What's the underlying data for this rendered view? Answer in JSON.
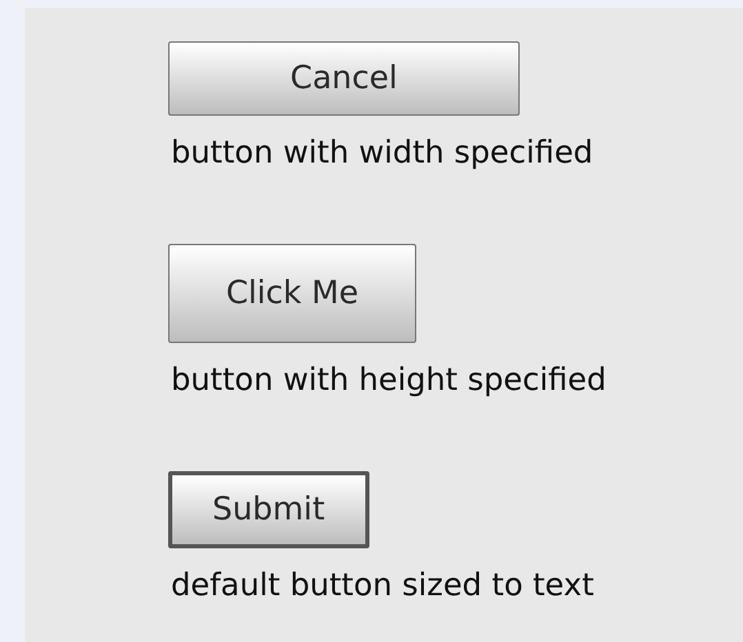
{
  "examples": [
    {
      "kind": "wide",
      "button": {
        "label": "Cancel",
        "default": false
      },
      "caption": "button with width specified"
    },
    {
      "kind": "tall",
      "button": {
        "label": "Click Me",
        "default": false
      },
      "caption": "button with height specified"
    },
    {
      "kind": "auto",
      "button": {
        "label": "Submit",
        "default": true
      },
      "caption": "default button sized to text"
    }
  ]
}
